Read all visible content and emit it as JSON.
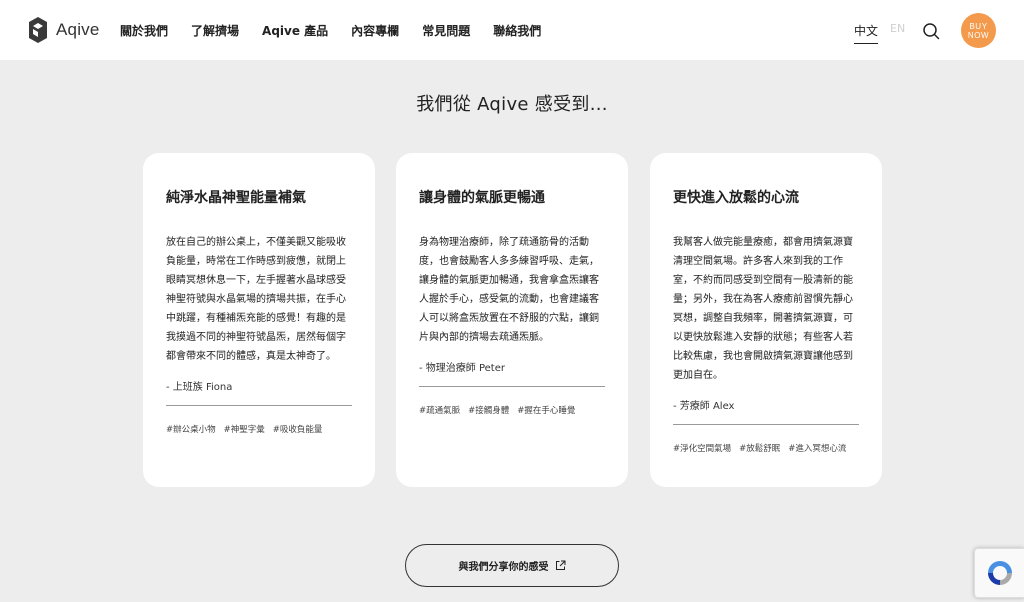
{
  "brand": {
    "logo_text": "Aqive"
  },
  "nav": {
    "items": [
      {
        "label": "關於我們"
      },
      {
        "label": "了解擠場"
      },
      {
        "label": "Aqive 產品"
      },
      {
        "label": "內容專欄"
      },
      {
        "label": "常見問題"
      },
      {
        "label": "聯絡我們"
      }
    ]
  },
  "lang": {
    "zh": "中文",
    "en": "EN"
  },
  "buy": {
    "line1": "BUY",
    "line2": "NOW"
  },
  "section": {
    "title": "我們從 Aqive 感受到..."
  },
  "cards": [
    {
      "title": "純淨水晶神聖能量補氣",
      "body": "放在自己的辦公桌上，不僅美觀又能吸收負能量，時常在工作時感到疲憊，就閉上眼睛冥想休息一下，左手握著水晶球感受神聖符號與水晶氣場的擠場共振，在手心中跳躍，有種補炁充能的感覺！有趣的是我摸過不同的神聖符號晶炁，居然每個字都會帶來不同的體感，真是太神奇了。",
      "author": "- 上班族 Fiona",
      "tags": [
        "#辦公桌小物",
        "#神聖字彙",
        "#吸收負能量"
      ]
    },
    {
      "title": "讓身體的氣脈更暢通",
      "body": "身為物理治療師，除了疏通筋骨的活動度，也會鼓勵客人多多練習呼吸、走氣，讓身體的氣脈更加暢通，我會拿盒炁讓客人握於手心，感受氣的流動，也會建議客人可以將盒炁放置在不舒服的穴點，讓銅片與內部的擠場去疏通炁脈。",
      "author": "- 物理治療師 Peter",
      "tags": [
        "#疏通氣脈",
        "#接觸身體",
        "#握在手心睡覺"
      ]
    },
    {
      "title": "更快進入放鬆的心流",
      "body": "我幫客人做完能量療癒，都會用擠氣源寶清理空間氣場。許多客人來到我的工作室，不約而同感受到空間有一股清新的能量；另外，我在為客人療癒前習慣先靜心冥想，調整自我頻率，開著擠氣源寶，可以更快放鬆進入安靜的狀態；有些客人若比較焦慮，我也會開啟擠氣源寶讓他感到更加自在。",
      "author": "- 芳療師 Alex",
      "tags": [
        "#淨化空間氣場",
        "#放鬆舒眠",
        "#進入冥想心流"
      ]
    }
  ],
  "share": {
    "label": "與我們分享你的感受"
  },
  "colors": {
    "accent": "#f39a4c",
    "background": "#eeeded"
  }
}
